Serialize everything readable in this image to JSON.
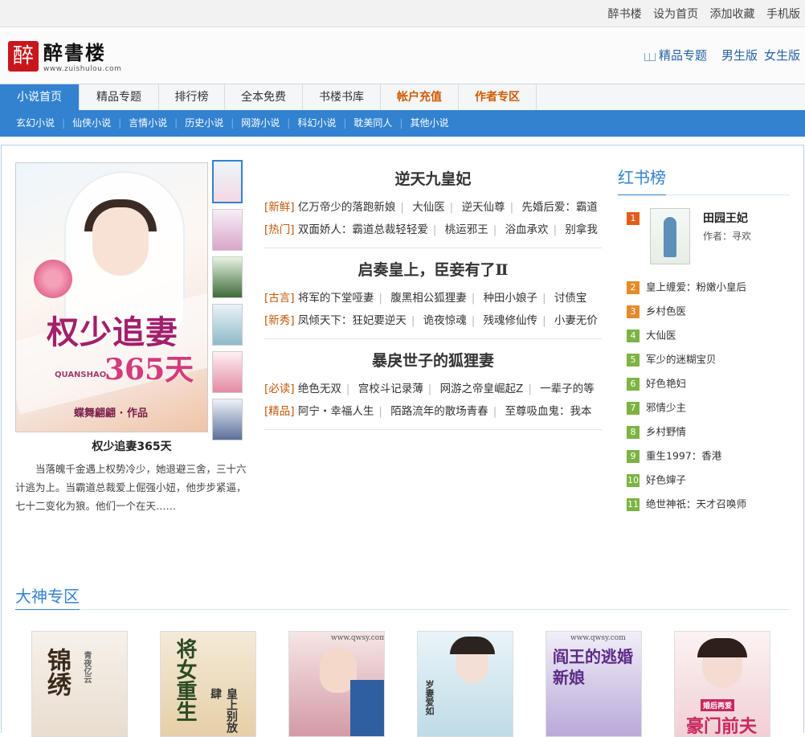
{
  "topbar": {
    "links": [
      "醉书楼",
      "设为首页",
      "添加收藏",
      "手机版"
    ]
  },
  "header": {
    "logo_seal": "醉",
    "logo_name": "醉書楼",
    "logo_url": "www.zuishulou.com",
    "special": "精品专题",
    "male": "男生版",
    "female": "女生版",
    "icons": {
      "special": "book-icon"
    }
  },
  "nav": {
    "tabs": [
      {
        "label": "小说首页",
        "style": "active"
      },
      {
        "label": "精品专题",
        "style": ""
      },
      {
        "label": "排行榜",
        "style": ""
      },
      {
        "label": "全本免费",
        "style": ""
      },
      {
        "label": "书楼书库",
        "style": ""
      },
      {
        "label": "帐户充值",
        "style": "hot"
      },
      {
        "label": "作者专区",
        "style": "hot"
      }
    ],
    "subnav": [
      "玄幻小说",
      "仙侠小说",
      "言情小说",
      "历史小说",
      "网游小说",
      "科幻小说",
      "耽美同人",
      "其他小说"
    ]
  },
  "featured": {
    "cover_title_1": "权少追妻",
    "cover_title_2": "365天",
    "cover_pinyin": "QUANSHAO",
    "cover_author": "蝶舞翩翩 · 作品",
    "title": "权少追妻365天",
    "desc": "当落魄千金遇上权势冷少，她退避三舍，三十六计逃为上。当霸道总裁爱上倔强小妞，他步步紧逼，七十二变化为狼。他们一个在天……"
  },
  "mid": [
    {
      "title": "逆天九皇妃",
      "lines": [
        {
          "cat": "[新鲜]",
          "items": [
            "亿万帝少的落跑新娘",
            "大仙医",
            "逆天仙尊",
            "先婚后爱：霸道"
          ]
        },
        {
          "cat": "[热门]",
          "items": [
            "双面娇人：霸道总裁轻轻爱",
            "桃运邪王",
            "浴血承欢",
            "别拿我"
          ]
        }
      ]
    },
    {
      "title": "启奏皇上，臣妾有了Ⅱ",
      "lines": [
        {
          "cat": "[古言]",
          "items": [
            "将军的下堂哑妻",
            "腹黑相公狐狸妻",
            "种田小娘子",
            "讨债宝"
          ]
        },
        {
          "cat": "[新秀]",
          "items": [
            "凤倾天下：狂妃要逆天",
            "诡夜惊魂",
            "残魂修仙传",
            "小妻无价"
          ]
        }
      ]
    },
    {
      "title": "暴戾世子的狐狸妻",
      "lines": [
        {
          "cat": "[必读]",
          "items": [
            "绝色无双",
            "宫校斗记录薄",
            "网游之帝皇崛起Z",
            "一辈子的等"
          ]
        },
        {
          "cat": "[精品]",
          "items": [
            "阿宁・幸福人生",
            "陌路流年的散场青春",
            "至尊吸血鬼：我本"
          ]
        }
      ]
    }
  ],
  "rank": {
    "title": "红书榜",
    "first": {
      "num": "1",
      "name": "田园王妃",
      "author": "作者：寻欢"
    },
    "items": [
      {
        "num": "2",
        "name": "皇上缠爱：粉嫩小皇后"
      },
      {
        "num": "3",
        "name": "乡村色医"
      },
      {
        "num": "4",
        "name": "大仙医"
      },
      {
        "num": "5",
        "name": "军少的迷糊宝贝"
      },
      {
        "num": "6",
        "name": "好色艳妇"
      },
      {
        "num": "7",
        "name": "邪情少主"
      },
      {
        "num": "8",
        "name": "乡村野情"
      },
      {
        "num": "9",
        "name": "重生1997：香港"
      },
      {
        "num": "10",
        "name": "好色婶子"
      },
      {
        "num": "11",
        "name": "绝世神祇：天才召唤师"
      }
    ]
  },
  "dashen": {
    "title": "大神专区",
    "covers": [
      {
        "text": "锦绣",
        "sub": "青夜亿云"
      },
      {
        "text": "将女重生",
        "sub": "皇上别放肆"
      },
      {
        "text": "",
        "sub": "www.qwsy.com"
      },
      {
        "text": "",
        "sub": "岁妻爱如"
      },
      {
        "text": "阎王的逃婚新娘",
        "sub": "www.qwsy.com"
      },
      {
        "text": "豪门前夫",
        "sub": "婚后再爱"
      }
    ]
  }
}
